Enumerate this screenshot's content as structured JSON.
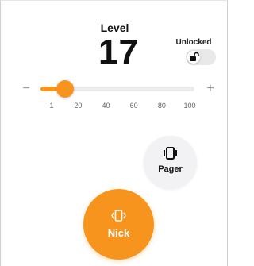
{
  "header": {
    "level_label": "Level",
    "level_value": "17"
  },
  "lock": {
    "label": "Unlocked",
    "state": "unlocked",
    "icon": "padlock-open-icon"
  },
  "slider": {
    "min": 1,
    "max": 100,
    "value": 17,
    "minus_symbol": "−",
    "plus_symbol": "+",
    "ticks": [
      "1",
      "20",
      "40",
      "60",
      "80",
      "100"
    ],
    "accent_color": "#f7941d"
  },
  "buttons": {
    "pager": {
      "label": "Pager",
      "icon": "vibrate-icon"
    },
    "nick": {
      "label": "Nick",
      "icon": "vibrate-icon",
      "color": "#f7941d"
    }
  }
}
